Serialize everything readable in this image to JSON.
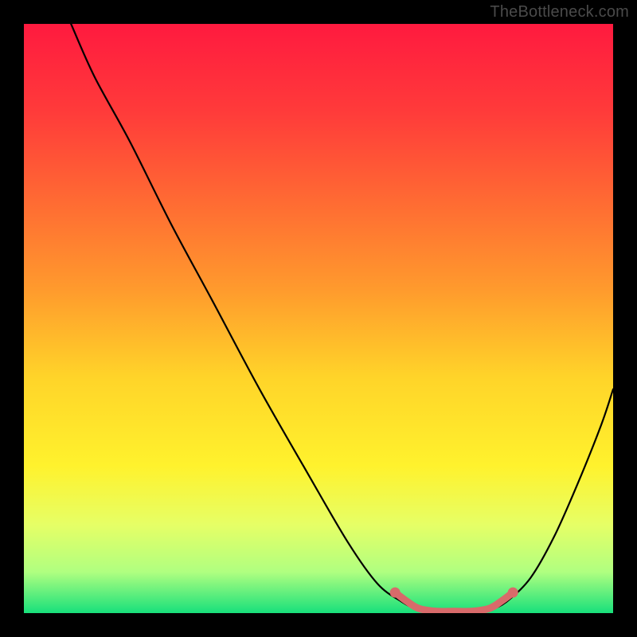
{
  "watermark": "TheBottleneck.com",
  "chart_data": {
    "type": "line",
    "title": "",
    "xlabel": "",
    "ylabel": "",
    "xlim": [
      0,
      100
    ],
    "ylim": [
      0,
      100
    ],
    "grid": false,
    "legend": false,
    "background_gradient": {
      "stops": [
        {
          "offset": 0.0,
          "color": "#ff1a3f"
        },
        {
          "offset": 0.15,
          "color": "#ff3b3a"
        },
        {
          "offset": 0.3,
          "color": "#ff6a33"
        },
        {
          "offset": 0.45,
          "color": "#ff9a2d"
        },
        {
          "offset": 0.6,
          "color": "#ffd429"
        },
        {
          "offset": 0.75,
          "color": "#fff22d"
        },
        {
          "offset": 0.85,
          "color": "#e6ff66"
        },
        {
          "offset": 0.93,
          "color": "#b0ff80"
        },
        {
          "offset": 1.0,
          "color": "#18e07b"
        }
      ]
    },
    "series": [
      {
        "name": "bottleneck-curve",
        "stroke": "#000000",
        "x": [
          8,
          12,
          18,
          25,
          32,
          40,
          48,
          55,
          60,
          64,
          67,
          70,
          73,
          76,
          79,
          82,
          86,
          90,
          94,
          98,
          100
        ],
        "y": [
          100,
          91,
          80,
          66,
          53,
          38,
          24,
          12,
          5,
          2,
          0.5,
          0,
          0,
          0,
          0.5,
          2,
          6,
          13,
          22,
          32,
          38
        ]
      },
      {
        "name": "optimal-range",
        "stroke": "#d86a6a",
        "is_marker_band": true,
        "x": [
          63,
          65,
          67,
          70,
          73,
          76,
          79,
          81,
          83
        ],
        "y": [
          3.5,
          2,
          0.8,
          0.3,
          0.3,
          0.3,
          0.8,
          2,
          3.5
        ]
      }
    ],
    "markers": [
      {
        "name": "left-endpoint",
        "x": 63,
        "y": 3.5,
        "color": "#d86a6a"
      },
      {
        "name": "right-endpoint",
        "x": 83,
        "y": 3.5,
        "color": "#d86a6a"
      }
    ]
  }
}
